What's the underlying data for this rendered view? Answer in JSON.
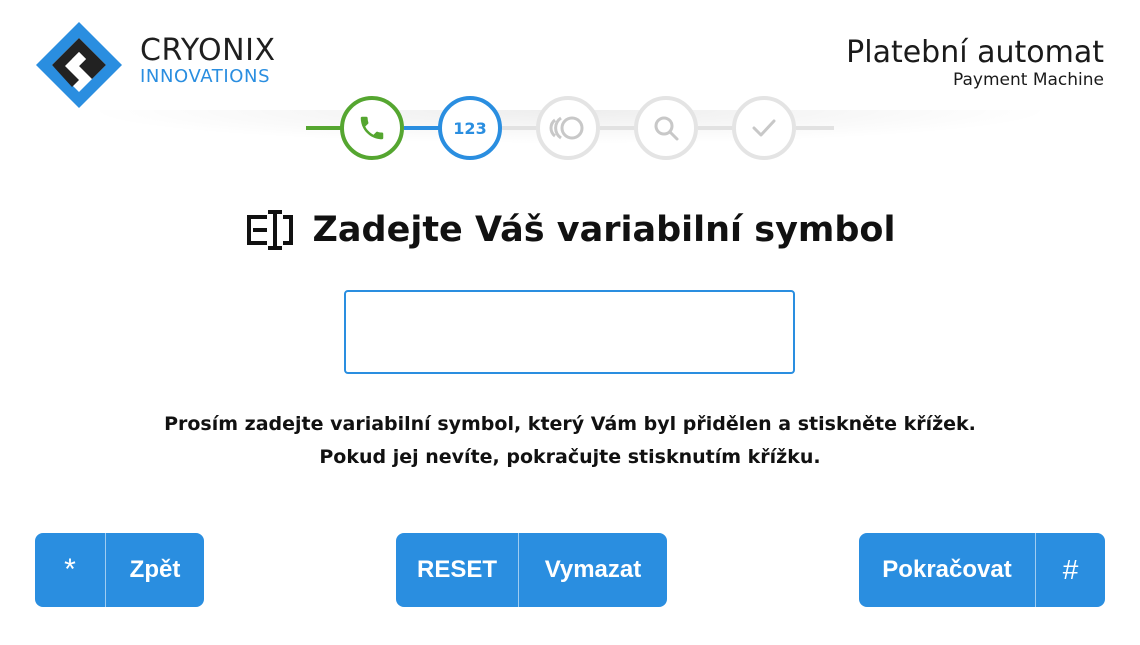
{
  "brand": {
    "name": "CRYONIX",
    "subtitle": "INNOVATIONS",
    "colors": {
      "dark": "#222222",
      "accent": "#2a8ee0"
    }
  },
  "header": {
    "title": "Platební automat",
    "subtitle": "Payment Machine"
  },
  "stepper": {
    "steps": [
      {
        "icon": "phone-icon",
        "state": "done"
      },
      {
        "icon": "numeric-123-icon",
        "label": "123",
        "state": "active"
      },
      {
        "icon": "contactless-card-icon",
        "state": "pending"
      },
      {
        "icon": "search-icon",
        "state": "pending"
      },
      {
        "icon": "checkmark-icon",
        "state": "pending"
      }
    ],
    "colors": {
      "done": "#55a630",
      "active": "#2a8ee0",
      "pending": "#e4e4e4"
    }
  },
  "main": {
    "icon": "text-cursor-icon",
    "heading": "Zadejte Váš variabilní symbol",
    "input": {
      "value": "",
      "placeholder": ""
    },
    "instructions": [
      "Prosím zadejte variabilní symbol, který Vám byl přidělen a stiskněte křížek.",
      "Pokud jej nevíte, pokračujte stisknutím křížku."
    ]
  },
  "buttons": {
    "back": {
      "key": "*",
      "label": "Zpět"
    },
    "reset": {
      "key": "RESET",
      "label": "Vymazat"
    },
    "next": {
      "label": "Pokračovat",
      "key": "#"
    },
    "color": "#2a8ee0"
  }
}
